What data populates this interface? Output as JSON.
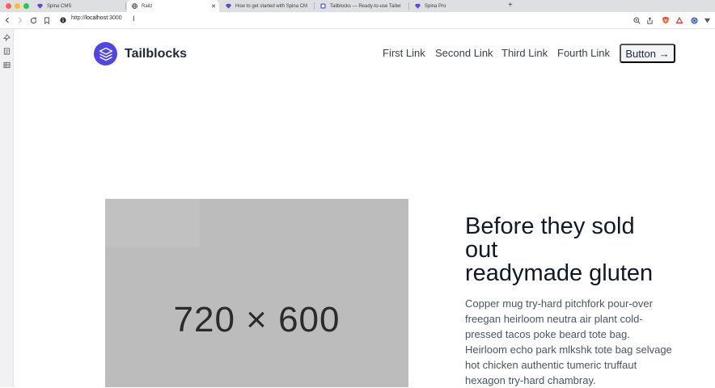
{
  "browser": {
    "tabs": [
      {
        "title": "Spina CMS",
        "favicon": "spina-gem-icon",
        "active": false
      },
      {
        "title": "Railz",
        "favicon": "globe-icon",
        "active": true
      },
      {
        "title": "How to get started with Spina CM",
        "favicon": "spina-gem-icon",
        "active": false
      },
      {
        "title": "Tailblocks — Ready-to-use Tailwi",
        "favicon": "tailblocks-icon",
        "active": false
      },
      {
        "title": "Spina Pro",
        "favicon": "spina-gem-icon",
        "active": false
      }
    ],
    "new_tab": "+",
    "url": {
      "scheme": "http://",
      "host": "localhost",
      "port": ":3000"
    }
  },
  "site": {
    "brand": "Tailblocks",
    "nav": [
      "First Link",
      "Second Link",
      "Third Link",
      "Fourth Link"
    ],
    "button": "Button →",
    "accent": "#4f46e5"
  },
  "hero": {
    "placeholder": "720 × 600",
    "headline": [
      "Before they sold",
      "out",
      "readymade gluten"
    ],
    "body": [
      "Copper mug try-hard pitchfork pour-over",
      "freegan heirloom neutra air plant cold-",
      "pressed tacos poke beard tote bag.",
      "Heirloom echo park mlkshk tote bag selvage",
      "hot chicken authentic tumeric truffaut",
      "hexagon try-hard chambray."
    ]
  }
}
